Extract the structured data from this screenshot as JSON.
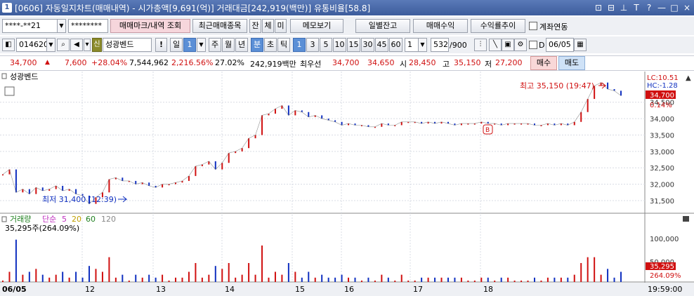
{
  "window": {
    "number": "1",
    "title": "[0606] 자동일지차트(매매내역) - 시가총액[9,691(억)] 거래대금[242,919(백만)] 유통비율[58.8]",
    "buttons": [
      "⊡",
      "⊟",
      "⊥",
      "T",
      "?",
      "—",
      "□",
      "×"
    ]
  },
  "toolbar1": {
    "account": "****-**21",
    "password": "********",
    "trade_mark_btn": "매매마크/내역 조회",
    "recent_btn": "최근매매종목",
    "tab_jan": "잔",
    "tab_che": "체",
    "tab_mi": "미",
    "memo_btn": "메모보기",
    "daily_balance_btn": "일별잔고",
    "trade_profit_btn": "매매수익",
    "profit_trend_btn": "수익률추이",
    "account_link_label": "계좌연동"
  },
  "toolbar2": {
    "code": "014620",
    "badge": "신",
    "name": "성광벤드",
    "period_il": "일",
    "period_num": "1",
    "periods": [
      "주",
      "월",
      "년",
      "분",
      "초",
      "틱"
    ],
    "selected_period": "분",
    "minute_options": [
      "1",
      "3",
      "5",
      "10",
      "15",
      "30",
      "45",
      "60"
    ],
    "selected_minute": "1",
    "custom_value": "1",
    "count": "532",
    "count_total": "/900",
    "d_label": "D",
    "date": "06/05"
  },
  "quote": {
    "price": "34,700",
    "change": "7,600",
    "change_pct": "+28.04%",
    "volume": "7,544,962",
    "volume_pct": "2,216.56%",
    "turnover": "27.02%",
    "amount": "242,919백만",
    "best_ask_label": "최우선",
    "best_ask": "34,700",
    "best_bid": "34,650",
    "open_label": "시",
    "open": "28,450",
    "high_label": "고",
    "high": "35,150",
    "low_label": "저",
    "low": "27,200",
    "buy_btn": "매수",
    "sell_btn": "매도"
  },
  "chart": {
    "price_panel_title": "성광벤드",
    "lc": "LC:10.51",
    "hc": "HC:-1.28",
    "last_price_tag": "34,700",
    "last_pct_tag": "0.14%",
    "high_annotation": "최고 35,150 (19:47)",
    "low_annotation": "최저 31,400 (12:39)",
    "marker": "B",
    "volume_panel": {
      "indicator": "거래량",
      "ma_label": "단순",
      "ma_periods": [
        "5",
        "20",
        "60",
        "120"
      ],
      "volume_readout": "35,295주(264.09%)",
      "last_volume_tag": "35,295",
      "last_volume_pct_tag": "264.09%",
      "axis_ticks": [
        "100,000",
        "50,000"
      ]
    },
    "x_labels": [
      "06/05",
      "12",
      "13",
      "14",
      "15",
      "16",
      "17",
      "18"
    ],
    "time_label": "19:59:00"
  },
  "chart_data": {
    "type": "line",
    "title": "성광벤드",
    "xlabel": "",
    "ylabel": "",
    "ylim": [
      31200,
      35350
    ],
    "y_ticks": [
      31500,
      32000,
      32500,
      33000,
      33500,
      34000,
      34500
    ],
    "x_categories": [
      "06/05",
      "12",
      "13",
      "14",
      "15",
      "16",
      "17",
      "18"
    ],
    "series": [
      {
        "values": [
          32300,
          32450,
          31750,
          31850,
          31700,
          31900,
          31800,
          31850,
          31950,
          31800,
          31850,
          31700,
          31650,
          31400,
          31600,
          31750,
          32150,
          32200,
          32100,
          32100,
          32000,
          32050,
          31950,
          31900,
          32000,
          32000,
          32050,
          32100,
          32250,
          32550,
          32600,
          32700,
          32450,
          32650,
          32950,
          33000,
          33100,
          33400,
          33500,
          34100,
          34150,
          34300,
          34400,
          34100,
          34250,
          34200,
          34050,
          34100,
          34000,
          33950,
          33900,
          33800,
          33850,
          33800,
          33800,
          33750,
          33750,
          33850,
          33800,
          33800,
          33900,
          33900,
          33900,
          33850,
          33900,
          33850,
          33900,
          33850,
          33800,
          33850,
          33850,
          33850,
          33900,
          33850,
          33850,
          33800,
          33850,
          33850,
          33850,
          33850,
          33800,
          33800,
          33850,
          33800,
          33850,
          33800,
          33900,
          34200,
          34600,
          35000,
          35100,
          34900,
          34850,
          34700
        ]
      }
    ],
    "high": 35150,
    "low": 31400,
    "volume_axis_ticks": [
      50000,
      100000
    ],
    "grid": true
  }
}
